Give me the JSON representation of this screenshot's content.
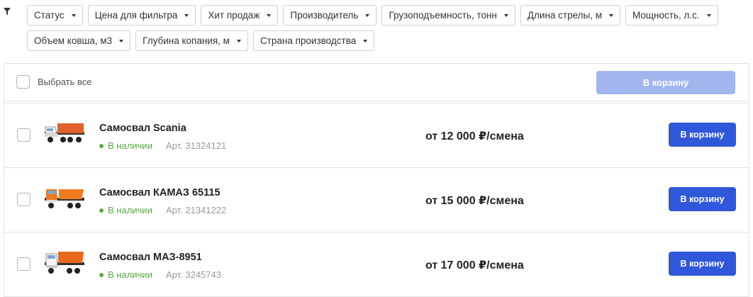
{
  "filters": {
    "row1": [
      "Статус",
      "Цена для фильтра",
      "Хит продаж",
      "Производитель",
      "Грузоподъемность, тонн",
      "Длина стрелы, м",
      "Мощность, л.с."
    ],
    "row2": [
      "Объем ковша, м3",
      "Глубина копания, м",
      "Страна производства"
    ]
  },
  "toolbar": {
    "select_all_label": "Выбрать все",
    "cart_button": "В корзину"
  },
  "products": [
    {
      "name": "Самосвал Scania",
      "stock": "В наличии",
      "sku": "Арт. 31324121",
      "price": "от 12 000 ₽/смена",
      "button": "В корзину",
      "truck_color": "#e0612a"
    },
    {
      "name": "Самосвал КАМАЗ 65115",
      "stock": "В наличии",
      "sku": "Арт. 21341222",
      "price": "от 15 000 ₽/смена",
      "button": "В корзину",
      "truck_color": "#f07a1e"
    },
    {
      "name": "Самосвал МАЗ-8951",
      "stock": "В наличии",
      "sku": "Арт. 3245743",
      "price": "от 17 000 ₽/смена",
      "button": "В корзину",
      "truck_color": "#e86a1f"
    }
  ],
  "colors": {
    "accent": "#2f57d9",
    "accent_disabled": "#a3b5ee",
    "in_stock": "#5aa845"
  }
}
